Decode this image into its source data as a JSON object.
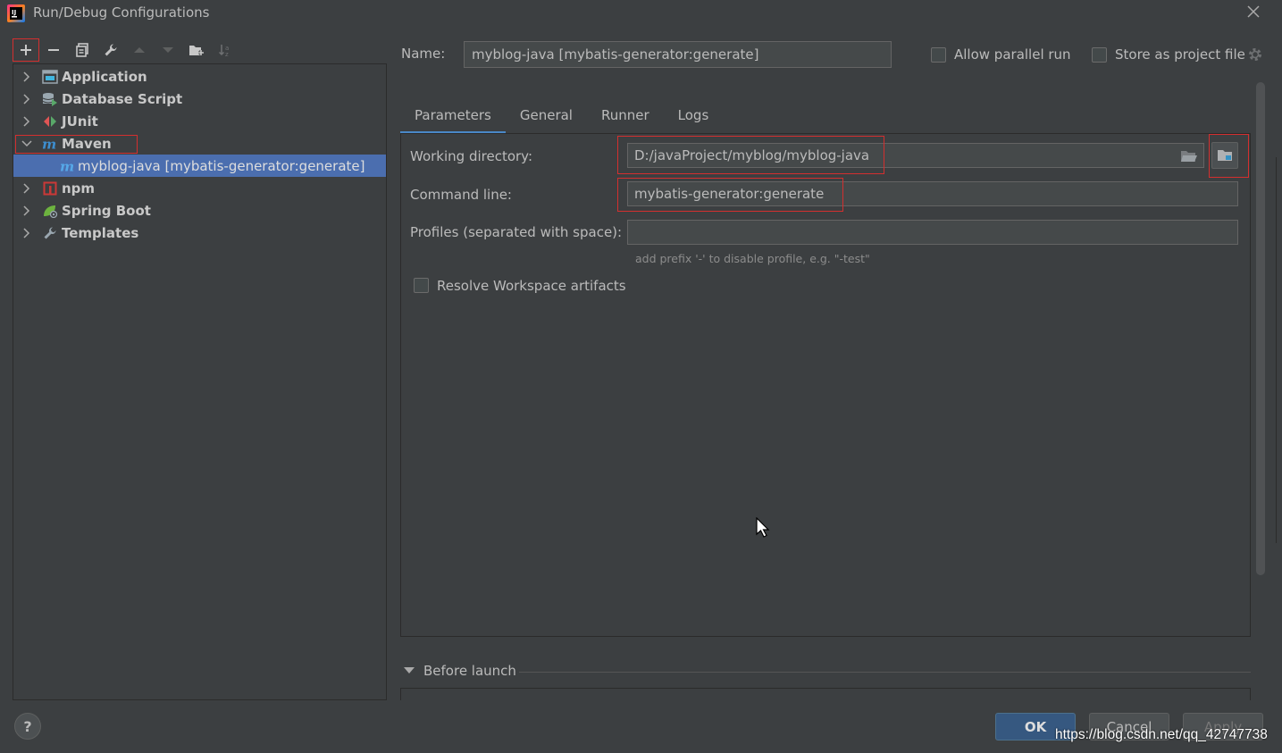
{
  "window": {
    "title": "Run/Debug Configurations"
  },
  "toolbar": {
    "buttons": [
      "add",
      "remove",
      "copy",
      "edit-templates",
      "move-up",
      "move-down",
      "new-folder",
      "sort"
    ]
  },
  "tree": {
    "items": [
      {
        "label": "Application",
        "icon": "application-icon",
        "expanded": false
      },
      {
        "label": "Database Script",
        "icon": "database-script-icon",
        "expanded": false
      },
      {
        "label": "JUnit",
        "icon": "junit-icon",
        "expanded": false
      },
      {
        "label": "Maven",
        "icon": "maven-icon",
        "expanded": true
      },
      {
        "label": "myblog-java [mybatis-generator:generate]",
        "icon": "maven-icon",
        "child": true,
        "selected": true
      },
      {
        "label": "npm",
        "icon": "npm-icon",
        "expanded": false
      },
      {
        "label": "Spring Boot",
        "icon": "spring-boot-icon",
        "expanded": false
      },
      {
        "label": "Templates",
        "icon": "wrench-icon",
        "expanded": false
      }
    ]
  },
  "header": {
    "name_label": "Name:",
    "name_value": "myblog-java [mybatis-generator:generate]",
    "allow_parallel_label": "Allow parallel run",
    "allow_parallel_checked": false,
    "store_project_label": "Store as project file",
    "store_project_checked": false
  },
  "tabs": [
    {
      "label": "Parameters",
      "active": true
    },
    {
      "label": "General",
      "active": false
    },
    {
      "label": "Runner",
      "active": false
    },
    {
      "label": "Logs",
      "active": false
    }
  ],
  "params": {
    "working_dir_label": "Working directory:",
    "working_dir_value": "D:/javaProject/myblog/myblog-java",
    "command_line_label": "Command line:",
    "command_line_value": "mybatis-generator:generate",
    "profiles_label": "Profiles (separated with space):",
    "profiles_value": "",
    "profiles_hint": "add prefix '-' to disable profile, e.g. \"-test\"",
    "resolve_label": "Resolve Workspace artifacts",
    "resolve_checked": false
  },
  "before_launch": {
    "label": "Before launch"
  },
  "buttons": {
    "help": "?",
    "ok": "OK",
    "cancel": "Cancel",
    "apply": "Apply"
  },
  "watermark": "https://blog.csdn.net/qq_42747738",
  "colors": {
    "background": "#3c3f41",
    "selection": "#4b6eaf",
    "accent": "#4a88c7",
    "annotation_red": "#d32f2f",
    "ok_button": "#365880"
  }
}
